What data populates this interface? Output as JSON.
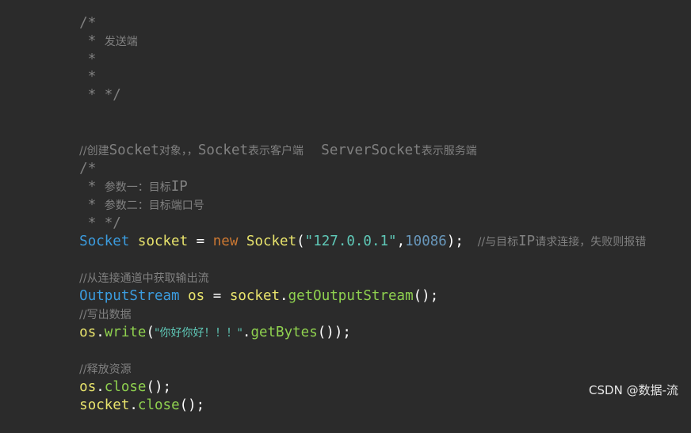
{
  "code": {
    "l1": "/*",
    "l2_star": " * ",
    "l2_text": "发送端",
    "l3": " *",
    "l4": " *",
    "l5": " * */",
    "c1_a": "//创建",
    "c1_b": "Socket",
    "c1_c": "对象，，",
    "c1_d": "Socket",
    "c1_e": "表示客户端     ",
    "c1_f": "ServerSocket",
    "c1_g": "表示服务端",
    "b1": "/*",
    "b2_star": " * ",
    "b2_text": "参数一：目标",
    "b2_ip": "IP",
    "b3_star": " * ",
    "b3_text": "参数二：目标端口号",
    "b4": " * */",
    "s1_type": "Socket",
    "s1_var": " socket",
    "s1_eq": " = ",
    "s1_new": "new",
    "s1_sp": " ",
    "s1_ctor": "Socket",
    "s1_open": "(",
    "s1_str": "\"127.0.0.1\"",
    "s1_comma": ",",
    "s1_num": "10086",
    "s1_close": ");",
    "s1_comment_a": "    //与目标",
    "s1_comment_ip": "IP",
    "s1_comment_b": "请求连接，失败则报错",
    "c2": "//从连接通道中获取输出流",
    "s2_type": "OutputStream",
    "s2_var": " os",
    "s2_eq": " = ",
    "s2_obj": "socket",
    "s2_dot": ".",
    "s2_method": "getOutputStream",
    "s2_end": "();",
    "c3": "//写出数据",
    "s3_obj": "os",
    "s3_dot": ".",
    "s3_method": "write",
    "s3_open": "(",
    "s3_str": "\"你好你好！！！\"",
    "s3_dot2": ".",
    "s3_method2": "getBytes",
    "s3_end": "());",
    "c4": "//释放资源",
    "s4_obj": "os",
    "s4_dot": ".",
    "s4_method": "close",
    "s4_end": "();",
    "s5_obj": "socket",
    "s5_dot": ".",
    "s5_method": "close",
    "s5_end": "();"
  },
  "watermark": "CSDN @数据-流",
  "colors": {
    "background": "#2b2b2b",
    "comment": "#808080",
    "type": "#3b9cdf",
    "variable": "#e8e36c",
    "keyword": "#cc7832",
    "method": "#8fd14f",
    "string": "#5fc8b7",
    "number": "#6897bb"
  }
}
